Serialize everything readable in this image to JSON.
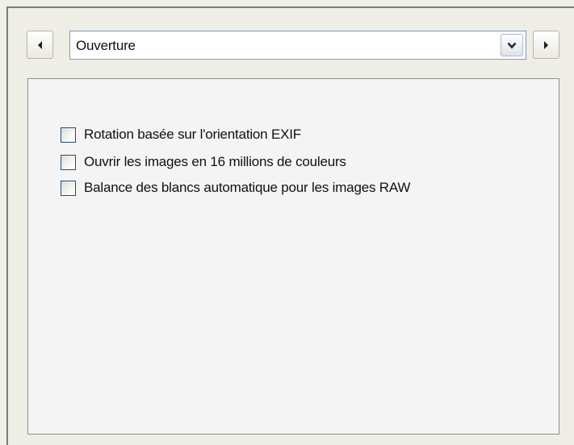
{
  "navigation": {
    "prev_icon": "arrow-left-icon",
    "next_icon": "arrow-right-icon"
  },
  "category_select": {
    "value": "Ouverture",
    "dropdown_icon": "chevron-down-icon"
  },
  "options": [
    {
      "label": "Rotation basée sur l'orientation EXIF",
      "checked": false
    },
    {
      "label": "Ouvrir les images en 16 millions de couleurs",
      "checked": false
    },
    {
      "label": "Balance des blancs automatique pour les images RAW",
      "checked": false
    }
  ]
}
